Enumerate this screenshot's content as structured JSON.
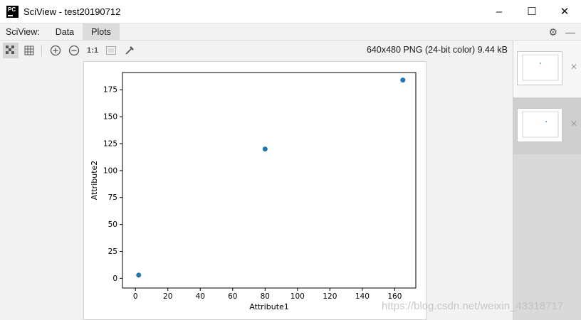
{
  "window": {
    "app_icon": "PC",
    "title": "SciView - test20190712",
    "minimize_icon": "–",
    "maximize_icon": "☐",
    "close_icon": "✕"
  },
  "tabs": {
    "prefix": "SciView:",
    "items": [
      {
        "label": "Data",
        "active": false
      },
      {
        "label": "Plots",
        "active": true
      }
    ],
    "settings_icon": "⚙",
    "hide_icon": "—"
  },
  "toolbar": {
    "zoom_reset_label": "1:1",
    "file_info": "640x480 PNG (24-bit color) 9.44 kB"
  },
  "thumbnails": {
    "close_icon": "✕"
  },
  "watermark": "https://blog.csdn.net/weixin_43318717",
  "chart_data": {
    "type": "scatter",
    "xlabel": "Attribute1",
    "ylabel": "Attribute2",
    "xlim": [
      -8,
      173
    ],
    "ylim": [
      -9,
      191
    ],
    "xticks": [
      0,
      20,
      40,
      60,
      80,
      100,
      120,
      140,
      160
    ],
    "yticks": [
      0,
      25,
      50,
      75,
      100,
      125,
      150,
      175
    ],
    "series": [
      {
        "x": [
          2,
          80,
          165
        ],
        "y": [
          3,
          120,
          184
        ]
      }
    ],
    "color": "#1f77b4",
    "grid": false
  }
}
